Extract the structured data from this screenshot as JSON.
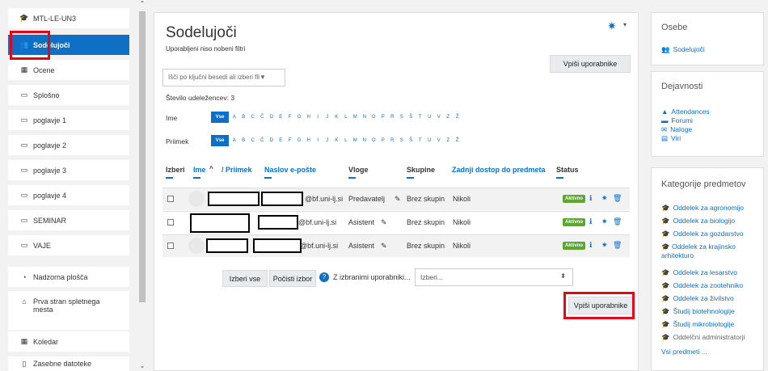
{
  "nav": {
    "items": [
      {
        "label": "MTL-LE-UN3",
        "icon": "graduation-cap-icon"
      },
      {
        "label": "Sodelujoči",
        "icon": "users-icon"
      },
      {
        "label": "Ocene",
        "icon": "table-icon"
      },
      {
        "label": "Splošno",
        "icon": "folder-icon"
      },
      {
        "label": "poglavje 1",
        "icon": "folder-icon"
      },
      {
        "label": "poglavje 2",
        "icon": "folder-icon"
      },
      {
        "label": "poglavje 3",
        "icon": "folder-icon"
      },
      {
        "label": "poglavje 4",
        "icon": "folder-icon"
      },
      {
        "label": "SEMINAR",
        "icon": "folder-icon"
      },
      {
        "label": "VAJE",
        "icon": "folder-icon"
      },
      {
        "label": "Nadzorna plošča",
        "icon": "dashboard-icon"
      },
      {
        "label": "Prva stran spletnega mesta",
        "icon": "home-icon"
      },
      {
        "label": "Koledar",
        "icon": "calendar-icon"
      },
      {
        "label": "Zasebne datoteke",
        "icon": "file-icon"
      }
    ]
  },
  "main": {
    "title": "Sodelujoči",
    "filters_note": "Uporabljeni niso nobeni filtri",
    "enrol_button": "Vpiši uporabnike",
    "search_placeholder": "Išči po ključni besedi ali izberi fil▼",
    "participant_count": "Število udeležencev: 3",
    "firstname_label": "Ime",
    "lastname_label": "Priimek",
    "all_label": "Vse",
    "letters": [
      "A",
      "B",
      "C",
      "Č",
      "D",
      "E",
      "F",
      "G",
      "H",
      "I",
      "J",
      "K",
      "L",
      "M",
      "N",
      "O",
      "P",
      "R",
      "S",
      "Š",
      "T",
      "U",
      "V",
      "Z",
      "Ž"
    ],
    "columns": {
      "select": "Izberi",
      "firstname": "Ime",
      "sort": "^",
      "lastname": "/ Priimek",
      "email": "Naslov e-pošte",
      "roles": "Vloge",
      "groups": "Skupine",
      "last_access": "Zadnji dostop do predmeta",
      "status": "Status"
    },
    "rows": [
      {
        "email": "@bf.uni-lj.si",
        "role": "Predavatelj",
        "group": "Brez skupin",
        "access": "Nikoli",
        "status": "Aktivno"
      },
      {
        "email": "@bf.uni-lj.si",
        "role": "Asistent",
        "group": "Brez skupin",
        "access": "Nikoli",
        "status": "Aktivno"
      },
      {
        "email": "@bf.uni-lj.si",
        "role": "Asistent",
        "group": "Brez skupin",
        "access": "Nikoli",
        "status": "Aktivno"
      }
    ],
    "select_all": "Izberi vse",
    "clear_selection": "Počisti izbor",
    "with_selected": "Z izbranimi uporabniki...",
    "select_value": "Izberi...",
    "enrol_button_bottom": "Vpiši uporabnike"
  },
  "right": {
    "people": {
      "title": "Osebe",
      "link": "Sodelujoči"
    },
    "activities": {
      "title": "Dejavnosti",
      "items": [
        "Attendances",
        "Forumi",
        "Naloge",
        "Viri"
      ]
    },
    "categories": {
      "title": "Kategorije predmetov",
      "items": [
        "Oddelek za agronomijo",
        "Oddelek za biologijo",
        "Oddelek za gozdarstvo",
        "Oddelek za krajinsko arhitekturo",
        "Oddelek za lesarstvo",
        "Oddelek za zootehniko",
        "Oddelek za živilstvo",
        "Študij biotehnologije",
        "Študij mikrobiologije",
        "Oddelčni administratorji"
      ],
      "all": "Vsi predmeti ..."
    }
  },
  "colors": {
    "accent": "#0f6fc5",
    "highlight": "#e30613",
    "active_badge": "#5aa832"
  }
}
